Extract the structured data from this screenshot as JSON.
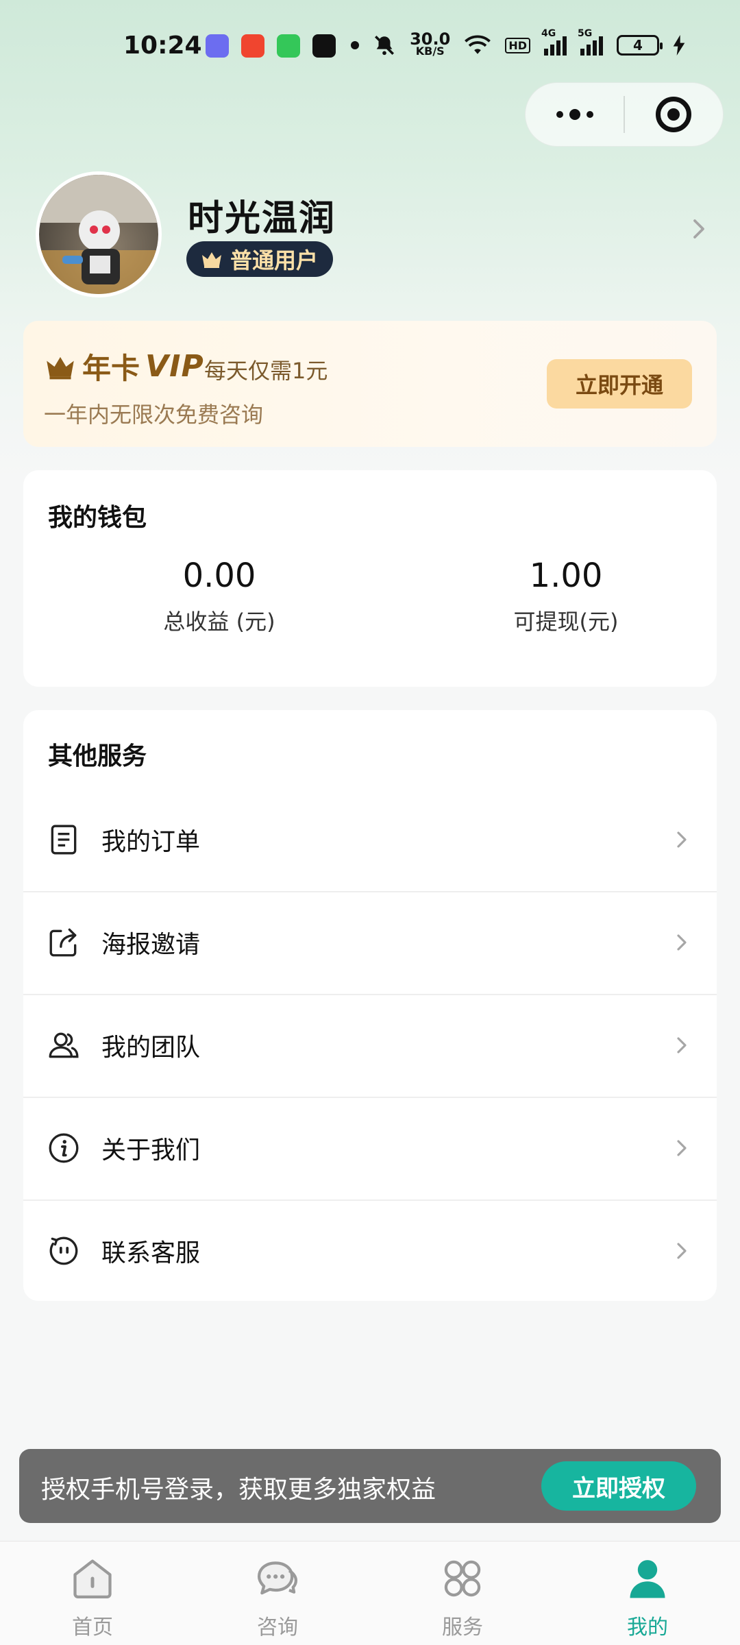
{
  "status_bar": {
    "time": "10:24",
    "net_speed": "30.0",
    "net_unit": "KB/S",
    "hd": "HD",
    "sig1": "4G",
    "sig2": "5G",
    "battery": "4"
  },
  "profile": {
    "nickname": "时光温润",
    "badge": "普通用户"
  },
  "vip": {
    "title_a": "年卡",
    "title_b": "VIP",
    "price": "每天仅需1元",
    "subtitle": "一年内无限次免费咨询",
    "button": "立即开通"
  },
  "wallet": {
    "title": "我的钱包",
    "items": [
      {
        "value": "0.00",
        "label": "总收益 (元)"
      },
      {
        "value": "1.00",
        "label": "可提现(元)"
      }
    ]
  },
  "services": {
    "title": "其他服务",
    "items": [
      {
        "label": "我的订单",
        "icon": "document-icon"
      },
      {
        "label": "海报邀请",
        "icon": "share-icon"
      },
      {
        "label": "我的团队",
        "icon": "team-icon"
      },
      {
        "label": "关于我们",
        "icon": "info-icon"
      },
      {
        "label": "联系客服",
        "icon": "customer-service-icon"
      }
    ]
  },
  "auth_bar": {
    "text": "授权手机号登录，获取更多独家权益",
    "button": "立即授权"
  },
  "tabbar": {
    "items": [
      {
        "label": "首页",
        "icon": "home-icon"
      },
      {
        "label": "咨询",
        "icon": "chat-icon"
      },
      {
        "label": "服务",
        "icon": "grid-icon"
      },
      {
        "label": "我的",
        "icon": "user-icon",
        "active": true
      }
    ]
  },
  "colors": {
    "accent": "#17b59f",
    "vip_gold": "#8a5a17",
    "badge_bg": "#1d2a3e"
  }
}
